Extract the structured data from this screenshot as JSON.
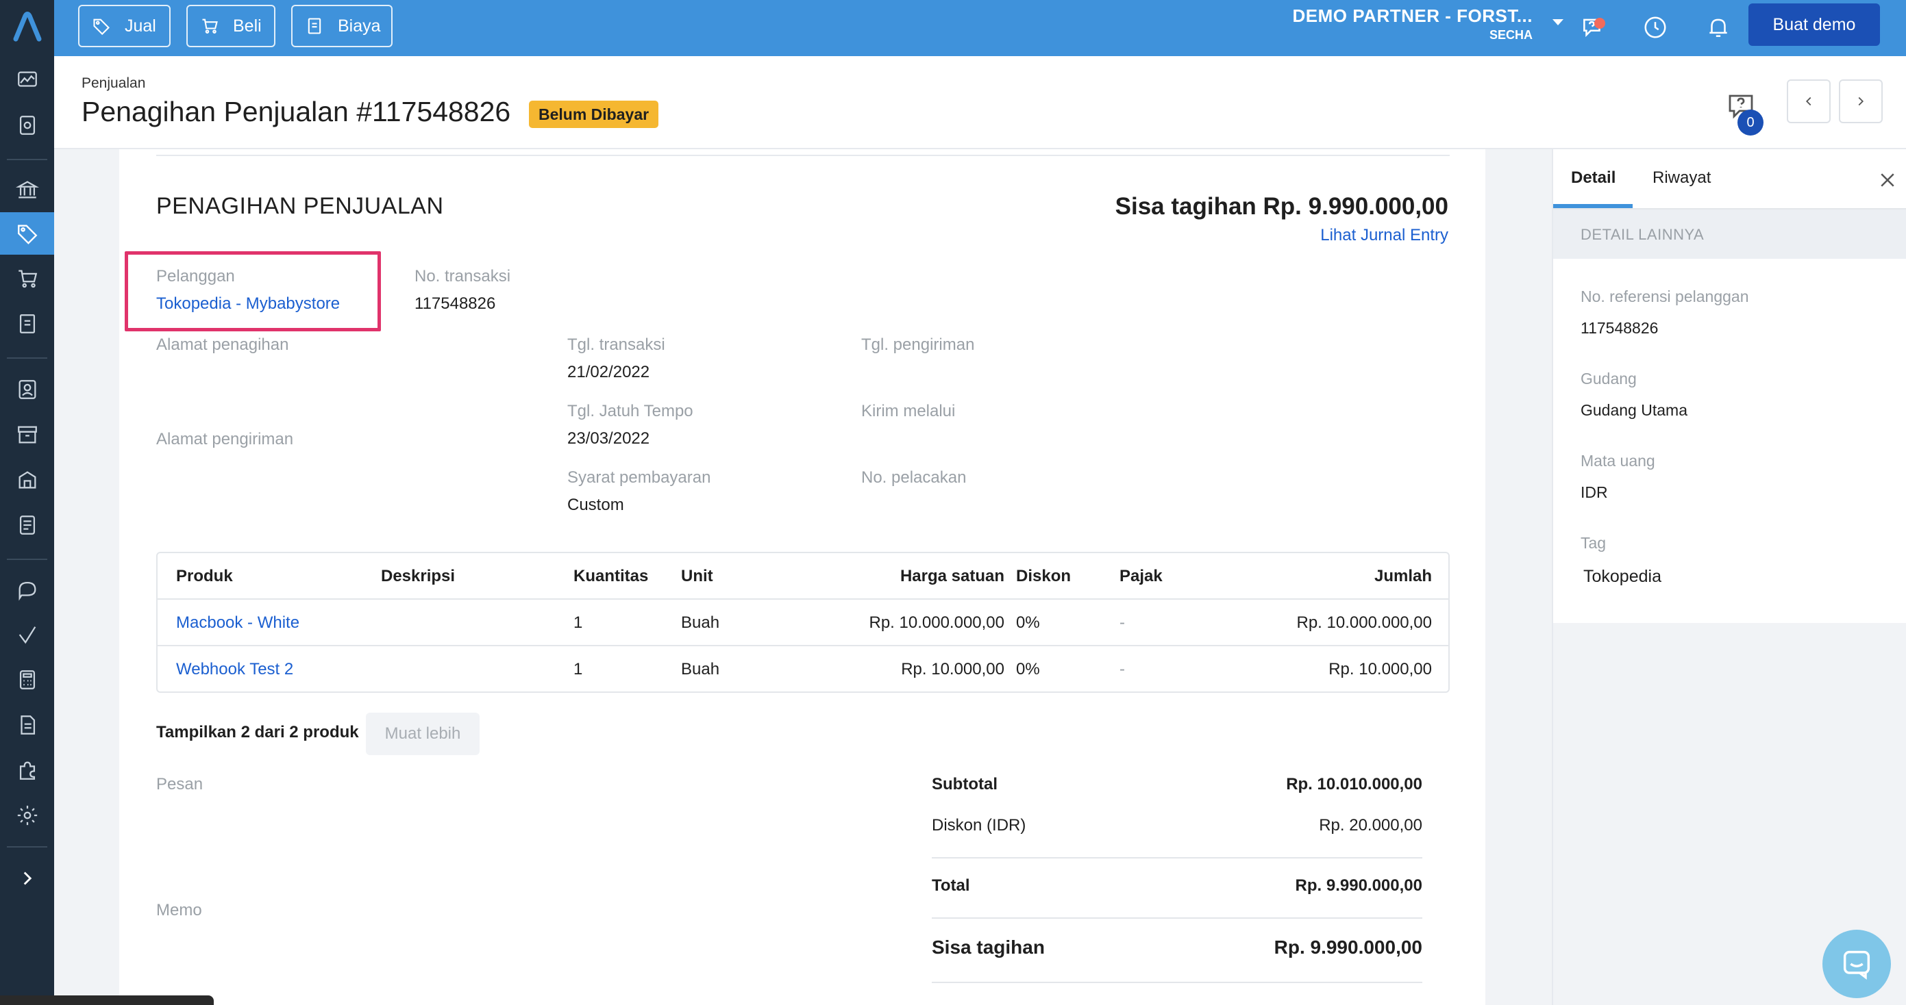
{
  "topbar": {
    "buttons": [
      {
        "label": "Jual",
        "icon": "tag-icon"
      },
      {
        "label": "Beli",
        "icon": "cart-icon"
      },
      {
        "label": "Biaya",
        "icon": "receipt-icon"
      }
    ],
    "company_name": "DEMO PARTNER - FORST...",
    "company_sub": "SECHA",
    "demo_button": "Buat demo"
  },
  "header": {
    "breadcrumb": "Penjualan",
    "title": "Penagihan Penjualan #117548826",
    "status": "Belum Dibayar",
    "comment_count": "0"
  },
  "invoice": {
    "heading": "PENAGIHAN PENJUALAN",
    "balance": "Sisa tagihan Rp. 9.990.000,00",
    "journal_link": "Lihat Jurnal Entry",
    "customer_label": "Pelanggan",
    "customer_value": "Tokopedia - Mybabystore",
    "trx_no_label": "No. transaksi",
    "trx_no_value": "117548826",
    "billing_addr_label": "Alamat penagihan",
    "shipping_addr_label": "Alamat pengiriman",
    "trx_date_label": "Tgl. transaksi",
    "trx_date_value": "21/02/2022",
    "ship_date_label": "Tgl. pengiriman",
    "due_date_label": "Tgl. Jatuh Tempo",
    "due_date_value": "23/03/2022",
    "ship_via_label": "Kirim melalui",
    "terms_label": "Syarat pembayaran",
    "terms_value": "Custom",
    "tracking_label": "No. pelacakan"
  },
  "products": {
    "headers": {
      "product": "Produk",
      "description": "Deskripsi",
      "qty": "Kuantitas",
      "unit": "Unit",
      "price": "Harga satuan",
      "discount": "Diskon",
      "tax": "Pajak",
      "amount": "Jumlah"
    },
    "rows": [
      {
        "product": "Macbook - White",
        "description": "",
        "qty": "1",
        "unit": "Buah",
        "price": "Rp. 10.000.000,00",
        "discount": "0%",
        "tax": "-",
        "amount": "Rp. 10.000.000,00"
      },
      {
        "product": "Webhook Test 2",
        "description": "",
        "qty": "1",
        "unit": "Buah",
        "price": "Rp. 10.000,00",
        "discount": "0%",
        "tax": "-",
        "amount": "Rp. 10.000,00"
      }
    ],
    "show_count": "Tampilkan 2 dari 2 produk",
    "load_more": "Muat lebih"
  },
  "notes": {
    "message_label": "Pesan",
    "memo_label": "Memo"
  },
  "summary": {
    "subtotal_label": "Subtotal",
    "subtotal_value": "Rp. 10.010.000,00",
    "discount_label": "Diskon (IDR)",
    "discount_value": "Rp. 20.000,00",
    "total_label": "Total",
    "total_value": "Rp. 9.990.000,00",
    "balance_label": "Sisa tagihan",
    "balance_value": "Rp. 9.990.000,00"
  },
  "panel": {
    "tab_detail": "Detail",
    "tab_history": "Riwayat",
    "section": "DETAIL LAINNYA",
    "ref_label": "No. referensi pelanggan",
    "ref_value": "117548826",
    "warehouse_label": "Gudang",
    "warehouse_value": "Gudang Utama",
    "currency_label": "Mata uang",
    "currency_value": "IDR",
    "tag_label": "Tag",
    "tag_value": "Tokopedia"
  },
  "colors": {
    "primary": "#3f92db",
    "sidebar": "#1e2d3d",
    "link": "#1b5fd0",
    "badge": "#f5b731",
    "highlight": "#e0336b"
  }
}
